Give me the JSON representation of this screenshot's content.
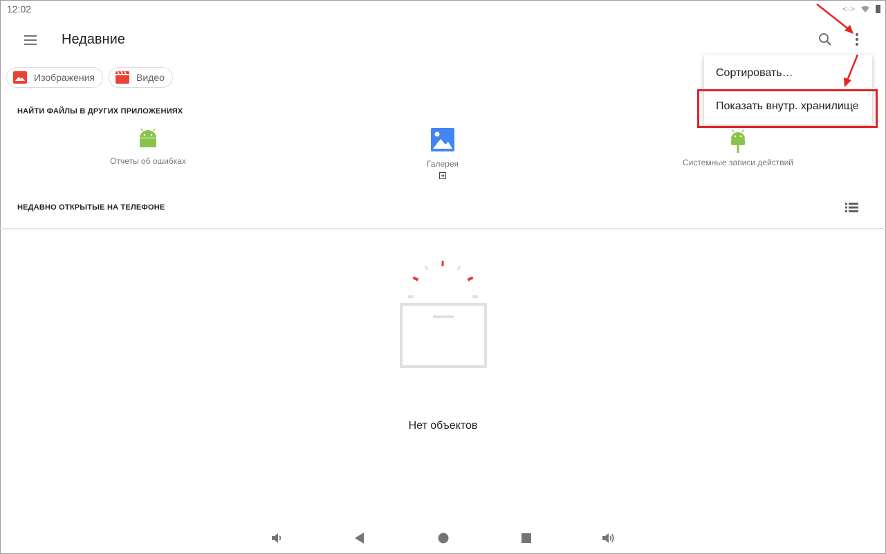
{
  "status_bar": {
    "time": "12:02",
    "icons": [
      "code-arrows-icon",
      "wifi-icon",
      "battery-icon"
    ]
  },
  "toolbar": {
    "title": "Недавние",
    "icons": [
      "menu-icon",
      "search-icon",
      "more-vert-icon"
    ]
  },
  "chips": [
    {
      "label": "Изображения",
      "icon": "image-icon"
    },
    {
      "label": "Видео",
      "icon": "video-icon"
    }
  ],
  "apps_section": {
    "label": "НАЙТИ ФАЙЛЫ В ДРУГИХ ПРИЛОЖЕНИЯХ",
    "apps": [
      {
        "label": "Отчеты об ошибках",
        "icon": "android-icon"
      },
      {
        "label": "Галерея",
        "icon": "gallery-icon"
      },
      {
        "label": "Системные записи действий",
        "icon": "android-icon"
      }
    ]
  },
  "recent_section": {
    "label": "НЕДАВНО ОТКРЫТЫЕ НА ТЕЛЕФОНЕ"
  },
  "empty": {
    "text": "Нет объектов"
  },
  "popup_menu": {
    "items": [
      {
        "label": "Сортировать…"
      },
      {
        "label": "Показать внутр. хранилище"
      }
    ]
  },
  "colors": {
    "annotation": "#e32322",
    "android_green": "#8bc34a",
    "gallery_blue": "#4285f4",
    "chip_red": "#ea4335"
  },
  "nav_bar": [
    "volume-down-icon",
    "back-icon",
    "home-icon",
    "recents-icon",
    "volume-up-icon"
  ]
}
